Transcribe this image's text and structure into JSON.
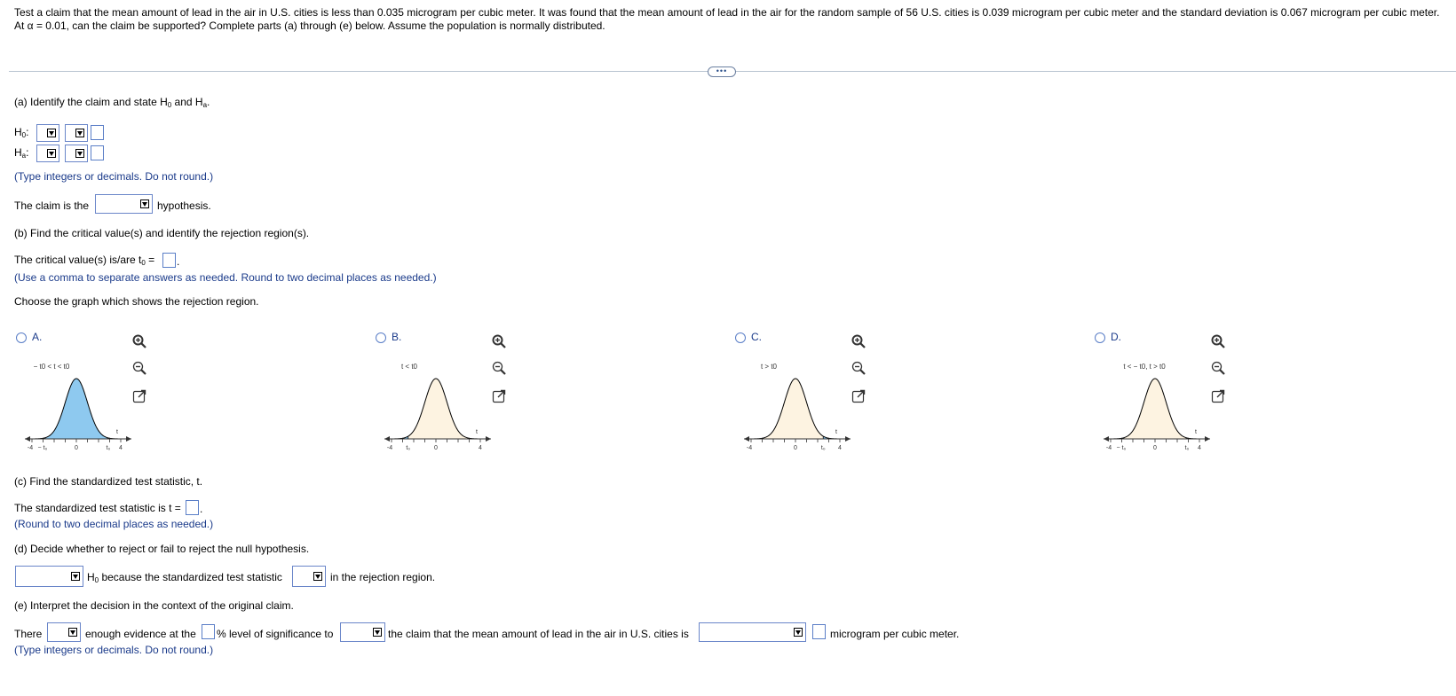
{
  "question": "Test a claim that the mean amount of lead in the air in U.S. cities is less than 0.035 microgram per cubic meter. It was found that the mean amount of lead in the air for the random sample of 56 U.S. cities is 0.039 microgram per cubic meter and the standard deviation is 0.067 microgram per cubic meter. At α = 0.01, can the claim be supported? Complete parts (a) through (e) below. Assume the population is normally distributed.",
  "more_button": "•••",
  "part_a": {
    "title_prefix": "(a) Identify the claim and state H",
    "title_mid": " and H",
    "title_end": ".",
    "sub0": "0",
    "suba": "a",
    "h0_label": "H",
    "ha_label": "H",
    "colon": ":",
    "hint": "(Type integers or decimals. Do not round.)",
    "claim_prefix": "The claim is the",
    "claim_suffix": "hypothesis."
  },
  "part_b": {
    "title": "(b) Find the critical value(s) and identify the rejection region(s).",
    "critical_prefix": "The critical value(s) is/are t",
    "critical_sub": "0",
    "critical_eq": " =",
    "hint": "(Use a comma to separate answers as needed. Round to two decimal places as needed.)",
    "choose": "Choose the graph which shows the rejection region."
  },
  "options": [
    {
      "label": "A.",
      "region": "− t0 < t < t0"
    },
    {
      "label": "B.",
      "region": "t < t0"
    },
    {
      "label": "C.",
      "region": "t > t0"
    },
    {
      "label": "D.",
      "region": "t < − t0, t > t0"
    }
  ],
  "part_c": {
    "title": "(c) Find the standardized test statistic, t.",
    "stat_prefix": "The standardized test statistic is t =",
    "hint": "(Round to two decimal places as needed.)"
  },
  "part_d": {
    "title": "(d) Decide whether to reject or fail to reject the null hypothesis.",
    "mid_text": " because the standardized test statistic",
    "h": "H",
    "sub0": "0",
    "end_text": "in the rejection region."
  },
  "part_e": {
    "title": "(e) Interpret the decision in the context of the original claim.",
    "there": "There",
    "enough": "enough evidence at the",
    "pct": "% level of significance to",
    "claim_text": "the claim that the mean amount of lead in the air in U.S. cities is",
    "unit": "microgram per cubic meter.",
    "hint": "(Type integers or decimals. Do not round.)"
  },
  "colors": {
    "blue_text": "#1a3a8a",
    "field_border": "#6a86c9",
    "rejection_fill": "#8ec9ef",
    "curve_fill": "#fdf3e1"
  }
}
